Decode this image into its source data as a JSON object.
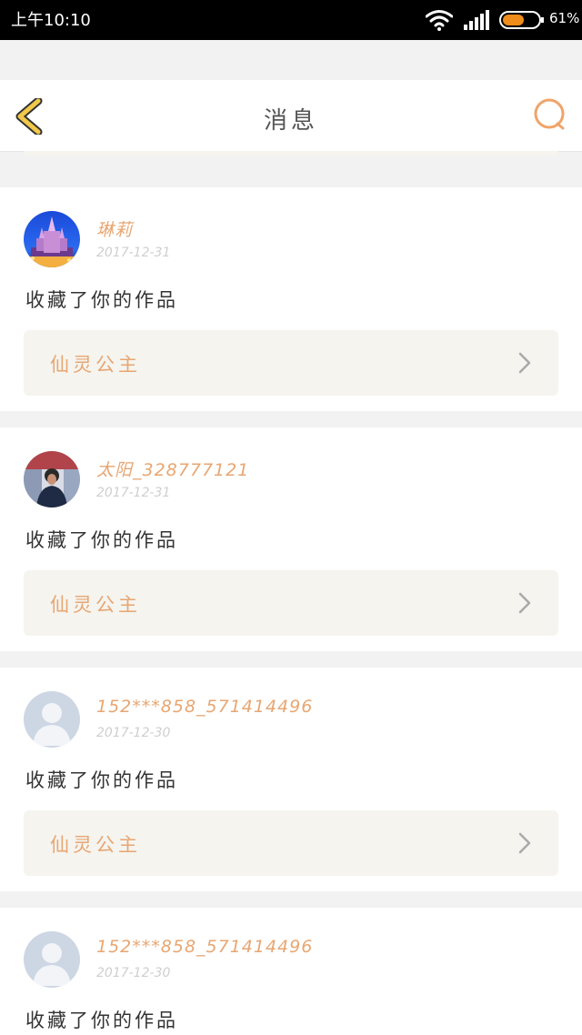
{
  "status_bar": {
    "time": "上午10:10",
    "battery_percent": "61%",
    "battery_level": 0.61
  },
  "header": {
    "title": "消息"
  },
  "messages": [
    {
      "username": "琳莉",
      "date": "2017-12-31",
      "action": "收藏了你的作品",
      "work_title": "仙灵公主",
      "avatar": "castle-photo-avatar"
    },
    {
      "username": "太阳_328777121",
      "date": "2017-12-31",
      "action": "收藏了你的作品",
      "work_title": "仙灵公主",
      "avatar": "person-photo-avatar"
    },
    {
      "username": "152***858_571414496",
      "date": "2017-12-30",
      "action": "收藏了你的作品",
      "work_title": "仙灵公主",
      "avatar": "default-user-avatar"
    },
    {
      "username": "152***858_571414496",
      "date": "2017-12-30",
      "action": "收藏了你的作品",
      "avatar": "default-user-avatar"
    }
  ],
  "colors": {
    "accent": "#e8a672",
    "back_arrow": "#f2c84b",
    "card_link_bg": "#f5f4ef"
  }
}
